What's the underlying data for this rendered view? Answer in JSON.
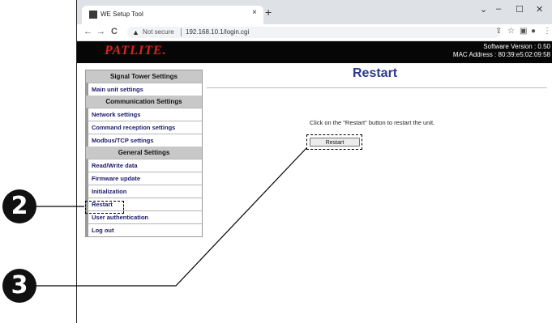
{
  "browser": {
    "tab_title": "WE Setup Tool",
    "tab_close": "×",
    "new_tab": "+",
    "window_controls": {
      "chevron": "⌄",
      "minimize": "–",
      "maximize": "☐",
      "close": "✕"
    },
    "nav": {
      "back": "←",
      "forward": "→",
      "reload": "C"
    },
    "security_label": "Not secure",
    "url": "192.168.10.1/login.cgi"
  },
  "header": {
    "logo": "PATLITE.",
    "software_version": "Software Version : 0.50",
    "mac_address": "MAC Address : 80:39:e5:02:09:58"
  },
  "sidebar": {
    "sections": [
      {
        "title": "Signal Tower Settings",
        "items": [
          "Main unit settings"
        ]
      },
      {
        "title": "Communication Settings",
        "items": [
          "Network settings",
          "Command reception settings",
          "Modbus/TCP settings"
        ]
      },
      {
        "title": "General Settings",
        "items": [
          "Read/Write data",
          "Firmware update",
          "Initialization",
          "Restart",
          "User authentication",
          "Log out"
        ]
      }
    ]
  },
  "main": {
    "title": "Restart",
    "instruction": "Click on the \"Restart\" button to restart the unit.",
    "restart_button": "Restart"
  },
  "callouts": {
    "two": "2",
    "three": "3"
  },
  "colors": {
    "logo": "#e0211b",
    "title": "#2d3a8c",
    "header_bg": "#060606",
    "section_bg": "#c8c8c8"
  }
}
